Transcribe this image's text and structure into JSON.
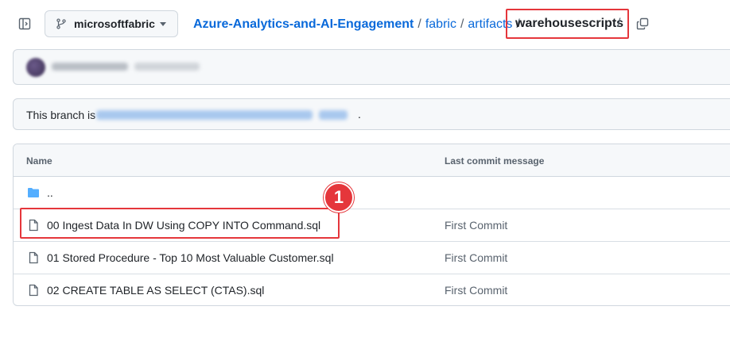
{
  "branch": {
    "name": "microsoftfabric"
  },
  "breadcrumb": {
    "repo": "Azure-Analytics-and-AI-Engagement",
    "separator": "/",
    "folders": [
      "fabric",
      "artifacts"
    ],
    "current": "warehousescripts",
    "trailing_sep": "/"
  },
  "branch_status": {
    "prefix": "This branch is",
    "suffix": "."
  },
  "table": {
    "headers": {
      "name": "Name",
      "message": "Last commit message"
    },
    "parent": "..",
    "rows": [
      {
        "name": "00 Ingest Data In DW Using COPY INTO Command.sql",
        "message": "First Commit"
      },
      {
        "name": "01 Stored Procedure - Top 10 Most Valuable Customer.sql",
        "message": "First Commit"
      },
      {
        "name": "02 CREATE TABLE AS SELECT (CTAS).sql",
        "message": "First Commit"
      }
    ]
  },
  "annotation": {
    "step": "1"
  },
  "colors": {
    "accent": "#0969da",
    "highlight": "#e5363b",
    "folder": "#54aeff"
  },
  "icons": [
    "sidebar-toggle-icon",
    "git-branch-icon",
    "chevron-down-icon",
    "copy-icon",
    "folder-icon",
    "file-icon"
  ]
}
